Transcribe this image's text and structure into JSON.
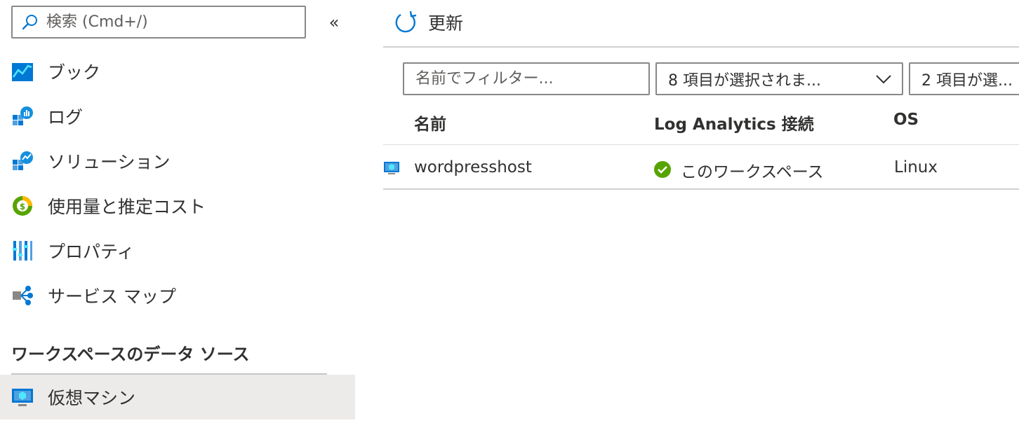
{
  "sidebar": {
    "search": {
      "placeholder": "検索 (Cmd+/)",
      "icon": "search-icon"
    },
    "collapse_label": "«",
    "items": [
      {
        "label": "ブック",
        "icon": "workbook-icon"
      },
      {
        "label": "ログ",
        "icon": "logs-icon"
      },
      {
        "label": "ソリューション",
        "icon": "solutions-icon"
      },
      {
        "label": "使用量と推定コスト",
        "icon": "usage-cost-icon"
      },
      {
        "label": "プロパティ",
        "icon": "properties-icon"
      },
      {
        "label": "サービス マップ",
        "icon": "service-map-icon"
      }
    ],
    "section_heading": "ワークスペースのデータ ソース",
    "active_item": {
      "label": "仮想マシン",
      "icon": "virtual-machine-icon"
    }
  },
  "toolbar": {
    "refresh_label": "更新",
    "refresh_icon": "refresh-icon"
  },
  "filters": {
    "name_placeholder": "名前でフィルター...",
    "dropdown1_value": "8 項目が選択されま...",
    "dropdown2_value": "2 項目が選..."
  },
  "table": {
    "columns": [
      "名前",
      "Log Analytics 接続",
      "OS"
    ],
    "rows": [
      {
        "name": "wordpresshost",
        "connection": "このワークスペース",
        "connection_status": "connected",
        "os": "Linux"
      }
    ]
  },
  "colors": {
    "accent": "#0078d4",
    "success": "#57a300",
    "active_bg": "#edebe9"
  }
}
